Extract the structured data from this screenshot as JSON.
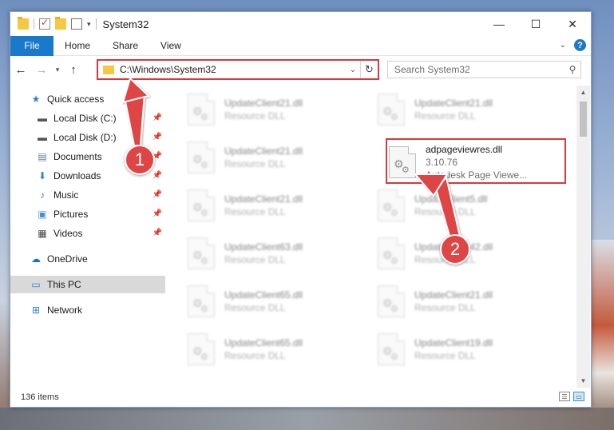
{
  "window": {
    "title": "System32",
    "controls": {
      "minimize": "—",
      "maximize": "☐",
      "close": "✕"
    }
  },
  "ribbon": {
    "tabs": [
      "File",
      "Home",
      "Share",
      "View"
    ],
    "help": "?"
  },
  "nav": {
    "address": "C:\\Windows\\System32",
    "search_placeholder": "Search System32"
  },
  "sidebar": {
    "items": [
      {
        "label": "Quick access",
        "icon": "star-icon"
      },
      {
        "label": "Local Disk (C:)",
        "icon": "drive-icon",
        "pinned": true
      },
      {
        "label": "Local Disk (D:)",
        "icon": "drive-icon",
        "pinned": true
      },
      {
        "label": "Documents",
        "icon": "document-icon",
        "pinned": true
      },
      {
        "label": "Downloads",
        "icon": "download-icon",
        "pinned": true
      },
      {
        "label": "Music",
        "icon": "music-icon",
        "pinned": true
      },
      {
        "label": "Pictures",
        "icon": "picture-icon",
        "pinned": true
      },
      {
        "label": "Videos",
        "icon": "video-icon",
        "pinned": true
      },
      {
        "label": "OneDrive",
        "icon": "cloud-icon"
      },
      {
        "label": "This PC",
        "icon": "computer-icon",
        "selected": true
      },
      {
        "label": "Network",
        "icon": "network-icon"
      }
    ]
  },
  "files": {
    "left": [
      {
        "name": "UpdateClient21.dll",
        "type": "Resource DLL"
      },
      {
        "name": "UpdateClient21.dll",
        "type": "Resource DLL"
      },
      {
        "name": "UpdateClient21.dll",
        "type": "Resource DLL"
      },
      {
        "name": "UpdateClient63.dll",
        "type": "Resource DLL"
      },
      {
        "name": "UpdateClient65.dll",
        "type": "Resource DLL"
      },
      {
        "name": "UpdateClient65.dll",
        "type": "Resource DLL"
      }
    ],
    "right": [
      {
        "name": "UpdateClient21.dll",
        "type": "Resource DLL"
      },
      {
        "name": "UpdateClient5.dll",
        "type": "Resource DLL"
      },
      {
        "name": "UpdateClient42.dll",
        "type": "Resource DLL"
      },
      {
        "name": "UpdateClient21.dll",
        "type": "Resource DLL"
      },
      {
        "name": "UpdateClient19.dll",
        "type": "Resource DLL"
      }
    ],
    "highlighted": {
      "name": "adpageviewres.dll",
      "version": "3.10.76",
      "description": "Autodesk Page Viewe..."
    }
  },
  "status": {
    "item_count": "136 items"
  },
  "annotations": {
    "step1": "1",
    "step2": "2",
    "color": "#e04545"
  }
}
